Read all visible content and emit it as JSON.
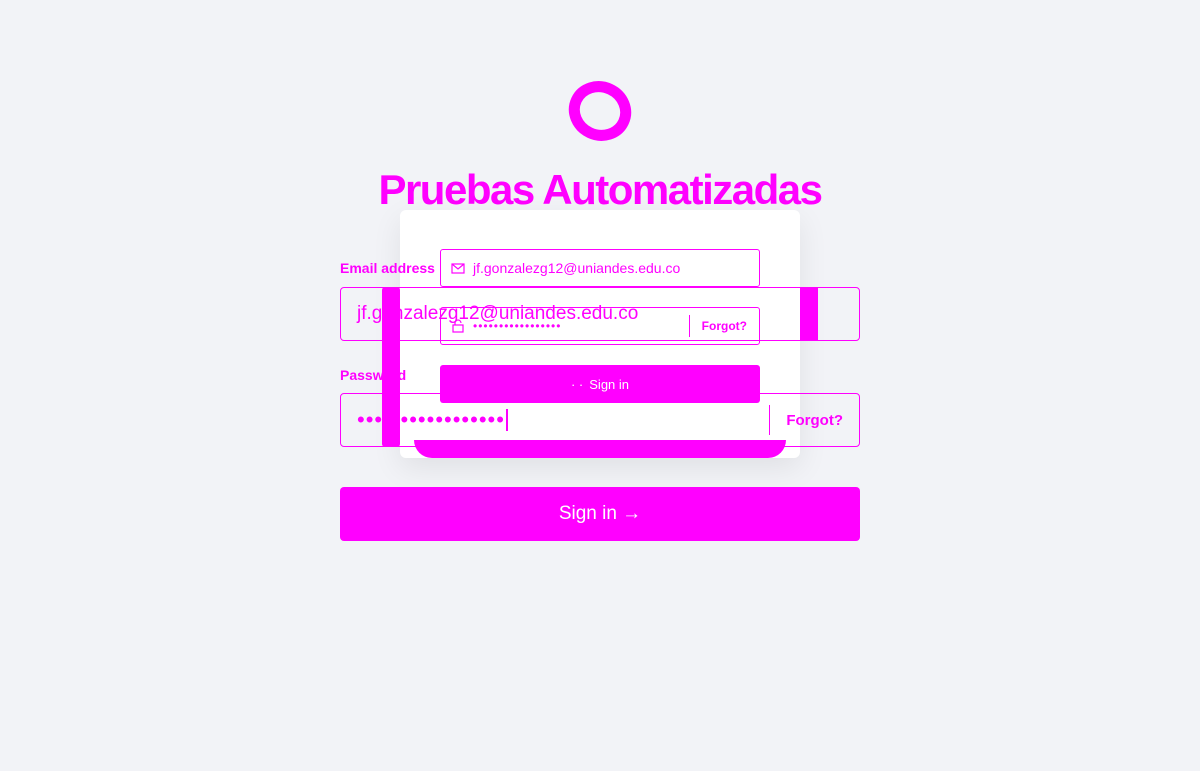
{
  "brand": {
    "logo_icon": "ring-logo-icon",
    "title": "Pruebas Automatizadas",
    "accent_color": "#ff00ff",
    "background_color": "#f2f3f7"
  },
  "ghost_form": {
    "email_value": "jf.gonzalezg12@uniandes.edu.co",
    "password_mask": "•••••••••••••••••",
    "forgot_label": "Forgot?",
    "signin_label": "Sign in",
    "signin_prefix": "· ·"
  },
  "form": {
    "email_label": "Email address",
    "email_value": "jf.gonzalezg12@uniandes.edu.co",
    "password_label": "Password",
    "password_mask": "•••••••••••••••••",
    "forgot_label": "Forgot?",
    "signin_label": "Sign in →"
  }
}
